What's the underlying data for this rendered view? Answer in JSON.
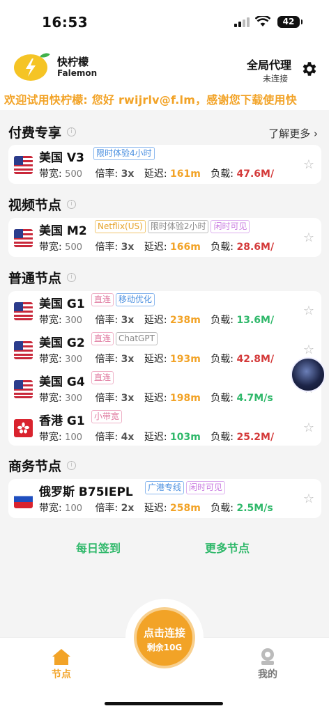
{
  "status_bar": {
    "time": "16:53",
    "battery": "42"
  },
  "header": {
    "brand_cn": "快柠檬",
    "brand_en": "Falemon",
    "proxy_mode": "全局代理",
    "proxy_status": "未连接"
  },
  "marquee": "欢迎试用快柠檬: 您好 rwijrlv@f.lm，感谢您下载使用快",
  "sections": {
    "paid": {
      "title": "付费专享",
      "link": "了解更多 ›"
    },
    "video": {
      "title": "视频节点"
    },
    "normal": {
      "title": "普通节点"
    },
    "business": {
      "title": "商务节点"
    }
  },
  "stat_labels": {
    "bandwidth": "带宽:",
    "rate": "倍率:",
    "latency": "延迟:",
    "load": "负载:"
  },
  "nodes": {
    "us_v3": {
      "name": "美国 V3",
      "tags": [
        "限时体验4小时"
      ],
      "bandwidth": "500",
      "rate": "3x",
      "latency": "161m",
      "load": "47.6M/"
    },
    "us_m2": {
      "name": "美国 M2",
      "tags": [
        "Netflix(US)",
        "限时体验2小时",
        "闲时可见"
      ],
      "bandwidth": "500",
      "rate": "3x",
      "latency": "166m",
      "load": "28.6M/"
    },
    "us_g1": {
      "name": "美国 G1",
      "tags": [
        "直连",
        "移动优化"
      ],
      "bandwidth": "300",
      "rate": "3x",
      "latency": "238m",
      "load": "13.6M/"
    },
    "us_g2": {
      "name": "美国 G2",
      "tags": [
        "直连",
        "ChatGPT"
      ],
      "bandwidth": "300",
      "rate": "3x",
      "latency": "193m",
      "load": "42.8M/"
    },
    "us_g4": {
      "name": "美国 G4",
      "tags": [
        "直连"
      ],
      "bandwidth": "300",
      "rate": "3x",
      "latency": "198m",
      "load": "4.7M/s"
    },
    "hk_g1": {
      "name": "香港 G1",
      "tags": [
        "小带宽"
      ],
      "bandwidth": "100",
      "rate": "4x",
      "latency": "103m",
      "load": "25.2M/"
    },
    "ru_b75": {
      "name": "俄罗斯 B75IEPL",
      "tags": [
        "广港专线",
        "闲时可见"
      ],
      "bandwidth": "100",
      "rate": "2x",
      "latency": "258m",
      "load": "2.5M/s"
    }
  },
  "actions": {
    "checkin": "每日签到",
    "more_nodes": "更多节点"
  },
  "connect": {
    "label": "点击连接",
    "remaining": "剩余10G"
  },
  "tabs": {
    "nodes": "节点",
    "mine": "我的"
  },
  "colors": {
    "accent": "#f2a327",
    "green": "#2fb86a",
    "red": "#d43a3a"
  },
  "icons": [
    "lemon-logo-icon",
    "gear-icon",
    "info-icon",
    "star-icon",
    "us-flag-icon",
    "hk-flag-icon",
    "ru-flag-icon",
    "home-icon",
    "profile-icon"
  ]
}
